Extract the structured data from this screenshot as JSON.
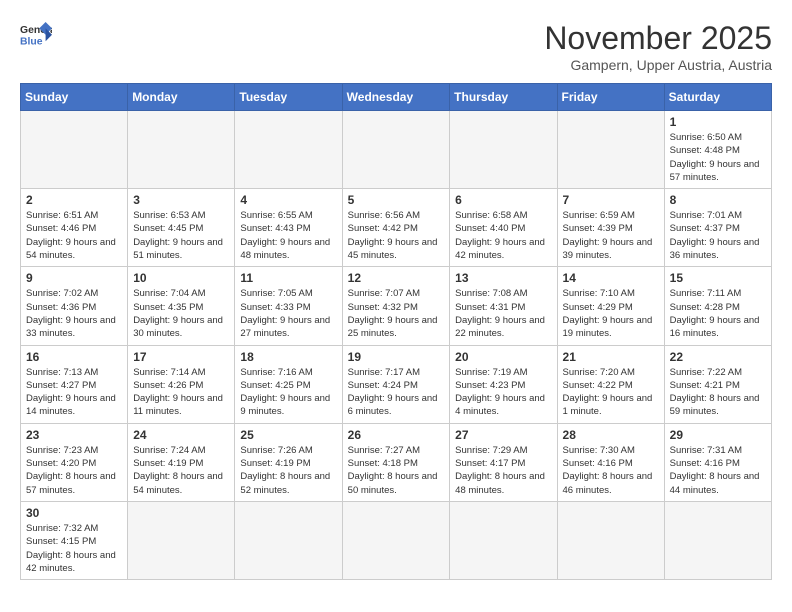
{
  "header": {
    "logo_general": "General",
    "logo_blue": "Blue",
    "month_year": "November 2025",
    "location": "Gampern, Upper Austria, Austria"
  },
  "weekdays": [
    "Sunday",
    "Monday",
    "Tuesday",
    "Wednesday",
    "Thursday",
    "Friday",
    "Saturday"
  ],
  "weeks": [
    [
      {
        "day": "",
        "info": ""
      },
      {
        "day": "",
        "info": ""
      },
      {
        "day": "",
        "info": ""
      },
      {
        "day": "",
        "info": ""
      },
      {
        "day": "",
        "info": ""
      },
      {
        "day": "",
        "info": ""
      },
      {
        "day": "1",
        "info": "Sunrise: 6:50 AM\nSunset: 4:48 PM\nDaylight: 9 hours and 57 minutes."
      }
    ],
    [
      {
        "day": "2",
        "info": "Sunrise: 6:51 AM\nSunset: 4:46 PM\nDaylight: 9 hours and 54 minutes."
      },
      {
        "day": "3",
        "info": "Sunrise: 6:53 AM\nSunset: 4:45 PM\nDaylight: 9 hours and 51 minutes."
      },
      {
        "day": "4",
        "info": "Sunrise: 6:55 AM\nSunset: 4:43 PM\nDaylight: 9 hours and 48 minutes."
      },
      {
        "day": "5",
        "info": "Sunrise: 6:56 AM\nSunset: 4:42 PM\nDaylight: 9 hours and 45 minutes."
      },
      {
        "day": "6",
        "info": "Sunrise: 6:58 AM\nSunset: 4:40 PM\nDaylight: 9 hours and 42 minutes."
      },
      {
        "day": "7",
        "info": "Sunrise: 6:59 AM\nSunset: 4:39 PM\nDaylight: 9 hours and 39 minutes."
      },
      {
        "day": "8",
        "info": "Sunrise: 7:01 AM\nSunset: 4:37 PM\nDaylight: 9 hours and 36 minutes."
      }
    ],
    [
      {
        "day": "9",
        "info": "Sunrise: 7:02 AM\nSunset: 4:36 PM\nDaylight: 9 hours and 33 minutes."
      },
      {
        "day": "10",
        "info": "Sunrise: 7:04 AM\nSunset: 4:35 PM\nDaylight: 9 hours and 30 minutes."
      },
      {
        "day": "11",
        "info": "Sunrise: 7:05 AM\nSunset: 4:33 PM\nDaylight: 9 hours and 27 minutes."
      },
      {
        "day": "12",
        "info": "Sunrise: 7:07 AM\nSunset: 4:32 PM\nDaylight: 9 hours and 25 minutes."
      },
      {
        "day": "13",
        "info": "Sunrise: 7:08 AM\nSunset: 4:31 PM\nDaylight: 9 hours and 22 minutes."
      },
      {
        "day": "14",
        "info": "Sunrise: 7:10 AM\nSunset: 4:29 PM\nDaylight: 9 hours and 19 minutes."
      },
      {
        "day": "15",
        "info": "Sunrise: 7:11 AM\nSunset: 4:28 PM\nDaylight: 9 hours and 16 minutes."
      }
    ],
    [
      {
        "day": "16",
        "info": "Sunrise: 7:13 AM\nSunset: 4:27 PM\nDaylight: 9 hours and 14 minutes."
      },
      {
        "day": "17",
        "info": "Sunrise: 7:14 AM\nSunset: 4:26 PM\nDaylight: 9 hours and 11 minutes."
      },
      {
        "day": "18",
        "info": "Sunrise: 7:16 AM\nSunset: 4:25 PM\nDaylight: 9 hours and 9 minutes."
      },
      {
        "day": "19",
        "info": "Sunrise: 7:17 AM\nSunset: 4:24 PM\nDaylight: 9 hours and 6 minutes."
      },
      {
        "day": "20",
        "info": "Sunrise: 7:19 AM\nSunset: 4:23 PM\nDaylight: 9 hours and 4 minutes."
      },
      {
        "day": "21",
        "info": "Sunrise: 7:20 AM\nSunset: 4:22 PM\nDaylight: 9 hours and 1 minute."
      },
      {
        "day": "22",
        "info": "Sunrise: 7:22 AM\nSunset: 4:21 PM\nDaylight: 8 hours and 59 minutes."
      }
    ],
    [
      {
        "day": "23",
        "info": "Sunrise: 7:23 AM\nSunset: 4:20 PM\nDaylight: 8 hours and 57 minutes."
      },
      {
        "day": "24",
        "info": "Sunrise: 7:24 AM\nSunset: 4:19 PM\nDaylight: 8 hours and 54 minutes."
      },
      {
        "day": "25",
        "info": "Sunrise: 7:26 AM\nSunset: 4:19 PM\nDaylight: 8 hours and 52 minutes."
      },
      {
        "day": "26",
        "info": "Sunrise: 7:27 AM\nSunset: 4:18 PM\nDaylight: 8 hours and 50 minutes."
      },
      {
        "day": "27",
        "info": "Sunrise: 7:29 AM\nSunset: 4:17 PM\nDaylight: 8 hours and 48 minutes."
      },
      {
        "day": "28",
        "info": "Sunrise: 7:30 AM\nSunset: 4:16 PM\nDaylight: 8 hours and 46 minutes."
      },
      {
        "day": "29",
        "info": "Sunrise: 7:31 AM\nSunset: 4:16 PM\nDaylight: 8 hours and 44 minutes."
      }
    ],
    [
      {
        "day": "30",
        "info": "Sunrise: 7:32 AM\nSunset: 4:15 PM\nDaylight: 8 hours and 42 minutes."
      },
      {
        "day": "",
        "info": ""
      },
      {
        "day": "",
        "info": ""
      },
      {
        "day": "",
        "info": ""
      },
      {
        "day": "",
        "info": ""
      },
      {
        "day": "",
        "info": ""
      },
      {
        "day": "",
        "info": ""
      }
    ]
  ]
}
